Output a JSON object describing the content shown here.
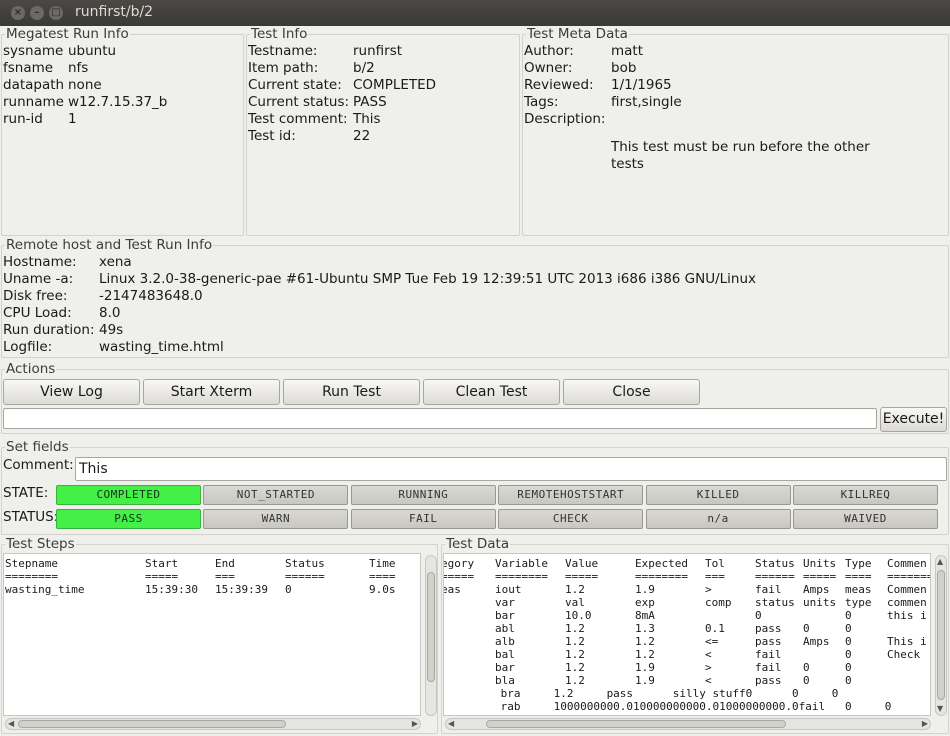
{
  "window": {
    "title": "runfirst/b/2"
  },
  "megatest_run_info": {
    "label": "Megatest Run Info",
    "rows": [
      {
        "key": "sysname",
        "value": "ubuntu"
      },
      {
        "key": "fsname",
        "value": "nfs"
      },
      {
        "key": "datapath",
        "value": "none"
      },
      {
        "key": "runname",
        "value": "w12.7.15.37_b"
      },
      {
        "key": "run-id",
        "value": "1"
      }
    ]
  },
  "test_info": {
    "label": "Test Info",
    "rows": [
      {
        "key": "Testname:",
        "value": "runfirst"
      },
      {
        "key": "Item path:",
        "value": "b/2"
      },
      {
        "key": "Current state:",
        "value": "COMPLETED"
      },
      {
        "key": "Current status:",
        "value": "PASS"
      },
      {
        "key": "Test comment:",
        "value": "This"
      },
      {
        "key": "Test id:",
        "value": "22"
      }
    ]
  },
  "test_meta": {
    "label": "Test Meta Data",
    "rows": [
      {
        "key": "Author:",
        "value": "matt"
      },
      {
        "key": "Owner:",
        "value": "bob"
      },
      {
        "key": "Reviewed:",
        "value": "1/1/1965"
      },
      {
        "key": "Tags:",
        "value": "first,single"
      },
      {
        "key": "Description:",
        "value": ""
      }
    ],
    "description_line1": "This test must be run before the other",
    "description_line2": "tests"
  },
  "remote": {
    "label": "Remote host and Test Run Info",
    "rows": [
      {
        "key": "Hostname:",
        "value": "xena"
      },
      {
        "key": "Uname -a:",
        "value": "Linux 3.2.0-38-generic-pae #61-Ubuntu SMP Tue Feb 19 12:39:51 UTC 2013 i686 i386 GNU/Linux"
      },
      {
        "key": "Disk free:",
        "value": "-2147483648.0"
      },
      {
        "key": "CPU Load:",
        "value": "8.0"
      },
      {
        "key": "Run duration:",
        "value": "49s"
      },
      {
        "key": "Logfile:",
        "value": "wasting_time.html"
      }
    ]
  },
  "actions": {
    "label": "Actions",
    "buttons": [
      "View Log",
      "Start Xterm",
      "Run Test",
      "Clean Test",
      "Close"
    ],
    "command_value": "",
    "execute_label": "Execute!"
  },
  "set_fields": {
    "label": "Set fields",
    "comment_label": "Comment:",
    "comment_value": "This",
    "state_label": "STATE:",
    "status_label": "STATUS:",
    "states": [
      {
        "label": "COMPLETED",
        "active": true
      },
      {
        "label": "NOT_STARTED",
        "active": false
      },
      {
        "label": "RUNNING",
        "active": false
      },
      {
        "label": "REMOTEHOSTSTART",
        "active": false
      },
      {
        "label": "KILLED",
        "active": false
      },
      {
        "label": "KILLREQ",
        "active": false
      }
    ],
    "statuses": [
      {
        "label": "PASS",
        "active": true
      },
      {
        "label": "WARN",
        "active": false
      },
      {
        "label": "FAIL",
        "active": false
      },
      {
        "label": "CHECK",
        "active": false
      },
      {
        "label": "n/a",
        "active": false
      },
      {
        "label": "WAIVED",
        "active": false
      }
    ],
    "active_color": "#44f048"
  },
  "test_steps": {
    "label": "Test Steps",
    "headers": [
      "Stepname",
      "Start",
      "End",
      "Status",
      "Time"
    ],
    "underlines": [
      "========",
      "=====",
      "===",
      "======",
      "===="
    ],
    "rows": [
      [
        "wasting_time",
        "15:39:30",
        "15:39:39",
        "0",
        "9.0s"
      ]
    ]
  },
  "test_data": {
    "label": "Test Data",
    "headers": [
      "egory",
      "Variable",
      "Value",
      "Expected",
      "Tol",
      "Status",
      "Units",
      "Type",
      "Commen"
    ],
    "underlines": [
      "=====",
      "========",
      "=====",
      "========",
      "===",
      "======",
      "=====",
      "====",
      "======="
    ],
    "rows": [
      [
        "eas",
        "iout",
        "1.2",
        "1.9",
        ">",
        "fail",
        "Amps",
        "meas",
        "Commen"
      ],
      [
        "",
        "var",
        "val",
        "exp",
        "comp",
        "status",
        "units",
        "type",
        "commen"
      ],
      [
        "",
        "bar",
        "10.0",
        "8mA",
        "",
        "0",
        "",
        "0",
        "this i"
      ],
      [
        "",
        "abl",
        "1.2",
        "1.3",
        "0.1",
        "pass",
        "0",
        "0",
        ""
      ],
      [
        "",
        "alb",
        "1.2",
        "1.2",
        "<=",
        "pass",
        "Amps",
        "0",
        "This i"
      ],
      [
        "",
        "bal",
        "1.2",
        "1.2",
        "<",
        "fail",
        "",
        "0",
        "Check"
      ],
      [
        "",
        "bar",
        "1.2",
        "1.9",
        ">",
        "fail",
        "0",
        "0",
        ""
      ],
      [
        "",
        "bla",
        "1.2",
        "1.9",
        "<",
        "pass",
        "0",
        "0",
        ""
      ]
    ],
    "raw_rows": [
      "         bra     1.2     pass      silly stuff0      0     0",
      "         rab     1000000000.010000000000.01000000000.0fail   0     0"
    ]
  }
}
